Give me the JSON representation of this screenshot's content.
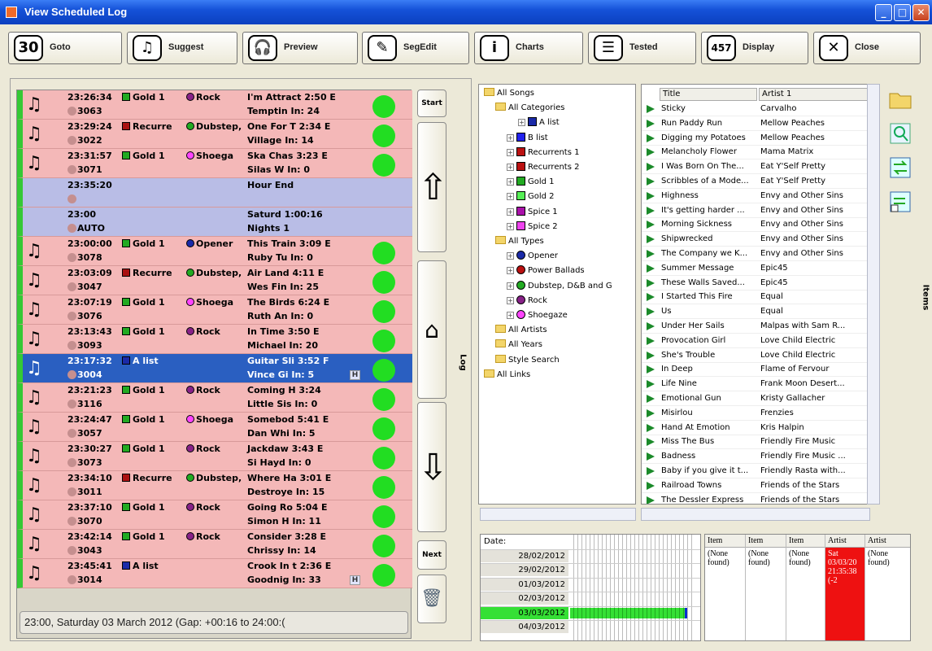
{
  "window": {
    "title": "View Scheduled Log"
  },
  "toolbar": [
    {
      "label": "Goto",
      "icon": "calendar-30-icon",
      "icon_text": "30"
    },
    {
      "label": "Suggest",
      "icon": "suggest-music-icon",
      "icon_text": "♫"
    },
    {
      "label": "Preview",
      "icon": "headphones-icon",
      "icon_text": "🎧"
    },
    {
      "label": "SegEdit",
      "icon": "segedit-icon",
      "icon_text": "✎"
    },
    {
      "label": "Charts",
      "icon": "info-icon",
      "icon_text": "i"
    },
    {
      "label": "Tested",
      "icon": "list-icon",
      "icon_text": "☰"
    },
    {
      "label": "Display",
      "icon": "display-counter-icon",
      "icon_text": "457"
    },
    {
      "label": "Close",
      "icon": "close-icon",
      "icon_text": "✕"
    }
  ],
  "log": {
    "rows": [
      {
        "time": "23:26:34",
        "cat": "Gold 1",
        "catcolor": "#22aa22",
        "type": "Rock",
        "typecolor": "#882288",
        "title": "I'm Attract 2:50 E",
        "num": "3063",
        "artist": "Temptin  In: 24",
        "blue": false,
        "sel": false,
        "h": false
      },
      {
        "time": "23:29:24",
        "cat": "Recurre",
        "catcolor": "#aa1111",
        "type": "Dubstep,",
        "typecolor": "#22aa22",
        "title": "One For T  2:34 E",
        "num": "3022",
        "artist": "Village   In: 14",
        "blue": false,
        "sel": false,
        "h": false
      },
      {
        "time": "23:31:57",
        "cat": "Gold 1",
        "catcolor": "#22aa22",
        "type": "Shoega",
        "typecolor": "#ff44ff",
        "title": "Ska Chas  3:23 E",
        "num": "3071",
        "artist": "Silas W  In: 0",
        "blue": false,
        "sel": false,
        "h": false
      },
      {
        "time": "23:35:20",
        "cat": "",
        "catcolor": "",
        "type": "",
        "typecolor": "",
        "title": "Hour End",
        "num": "",
        "artist": "",
        "blue": true,
        "sel": false,
        "h": false
      },
      {
        "time": "23:00",
        "cat": "",
        "catcolor": "",
        "type": "",
        "typecolor": "",
        "title": "Saturd  1:00:16",
        "num": "AUTO",
        "artist": "Nights 1",
        "blue": true,
        "sel": false,
        "h": false
      },
      {
        "time": "23:00:00",
        "cat": "Gold 1",
        "catcolor": "#22aa22",
        "type": "Opener",
        "typecolor": "#1a2aa8",
        "title": "This Train 3:09 E",
        "num": "3078",
        "artist": "Ruby Tu  In: 0",
        "blue": false,
        "sel": false,
        "h": false
      },
      {
        "time": "23:03:09",
        "cat": "Recurre",
        "catcolor": "#aa1111",
        "type": "Dubstep,",
        "typecolor": "#22aa22",
        "title": "Air Land  4:11 E",
        "num": "3047",
        "artist": "Wes Fin  In: 25",
        "blue": false,
        "sel": false,
        "h": false
      },
      {
        "time": "23:07:19",
        "cat": "Gold 1",
        "catcolor": "#22aa22",
        "type": "Shoega",
        "typecolor": "#ff44ff",
        "title": "The Birds  6:24 E",
        "num": "3076",
        "artist": "Ruth An  In: 0",
        "blue": false,
        "sel": false,
        "h": false
      },
      {
        "time": "23:13:43",
        "cat": "Gold 1",
        "catcolor": "#22aa22",
        "type": "Rock",
        "typecolor": "#882288",
        "title": "In Time    3:50 E",
        "num": "3093",
        "artist": "Michael  In: 20",
        "blue": false,
        "sel": false,
        "h": false
      },
      {
        "time": "23:17:32",
        "cat": "A list",
        "catcolor": "#1a2aa8",
        "type": "",
        "typecolor": "",
        "title": "Guitar Sli  3:52 F",
        "num": "3004",
        "artist": "Vince Gi  In: 5",
        "blue": false,
        "sel": true,
        "h": true
      },
      {
        "time": "23:21:23",
        "cat": "Gold 1",
        "catcolor": "#22aa22",
        "type": "Rock",
        "typecolor": "#882288",
        "title": "Coming H  3:24",
        "num": "3116",
        "artist": "Little Sis In: 0",
        "blue": false,
        "sel": false,
        "h": false
      },
      {
        "time": "23:24:47",
        "cat": "Gold 1",
        "catcolor": "#22aa22",
        "type": "Shoega",
        "typecolor": "#ff44ff",
        "title": "Somebod  5:41 E",
        "num": "3057",
        "artist": "Dan Whi  In: 5",
        "blue": false,
        "sel": false,
        "h": false
      },
      {
        "time": "23:30:27",
        "cat": "Gold 1",
        "catcolor": "#22aa22",
        "type": "Rock",
        "typecolor": "#882288",
        "title": "Jackdaw   3:43 E",
        "num": "3073",
        "artist": "Si Hayd  In: 0",
        "blue": false,
        "sel": false,
        "h": false
      },
      {
        "time": "23:34:10",
        "cat": "Recurre",
        "catcolor": "#aa1111",
        "type": "Dubstep,",
        "typecolor": "#22aa22",
        "title": "Where Ha  3:01 E",
        "num": "3011",
        "artist": "Destroye In: 15",
        "blue": false,
        "sel": false,
        "h": false
      },
      {
        "time": "23:37:10",
        "cat": "Gold 1",
        "catcolor": "#22aa22",
        "type": "Rock",
        "typecolor": "#882288",
        "title": "Going Ro  5:04 E",
        "num": "3070",
        "artist": "Simon H  In: 11",
        "blue": false,
        "sel": false,
        "h": false
      },
      {
        "time": "23:42:14",
        "cat": "Gold 1",
        "catcolor": "#22aa22",
        "type": "Rock",
        "typecolor": "#882288",
        "title": "Consider  3:28 E",
        "num": "3043",
        "artist": "Chrissy   In: 14",
        "blue": false,
        "sel": false,
        "h": false
      },
      {
        "time": "23:45:41",
        "cat": "A list",
        "catcolor": "#1a2aa8",
        "type": "",
        "typecolor": "",
        "title": "Crook In t  2:36 E",
        "num": "3014",
        "artist": "Goodnig  In: 33",
        "blue": false,
        "sel": false,
        "h": true
      }
    ],
    "status": "23:00, Saturday 03 March 2012 (Gap: +00:16 to 24:00:(",
    "h_badge": "H"
  },
  "nav": {
    "start": "Start",
    "next": "Next",
    "log_tab": "Log"
  },
  "tree": [
    {
      "label": "All Songs",
      "kind": "root",
      "indent": 0
    },
    {
      "label": "All Categories",
      "kind": "folder",
      "indent": 1
    },
    {
      "label": "A list",
      "kind": "sq",
      "color": "#1a2aa8",
      "indent": 3
    },
    {
      "label": "B list",
      "kind": "sq",
      "color": "#2222ee",
      "indent": 2
    },
    {
      "label": "Recurrents 1",
      "kind": "sq",
      "color": "#bb1111",
      "indent": 2
    },
    {
      "label": "Recurrents 2",
      "kind": "sq",
      "color": "#bb1111",
      "indent": 2
    },
    {
      "label": "Gold 1",
      "kind": "sq",
      "color": "#22aa22",
      "indent": 2
    },
    {
      "label": "Gold 2",
      "kind": "sq",
      "color": "#55ee55",
      "indent": 2
    },
    {
      "label": "Spice 1",
      "kind": "sq",
      "color": "#aa11aa",
      "indent": 2
    },
    {
      "label": "Spice 2",
      "kind": "sq",
      "color": "#ee44ee",
      "indent": 2
    },
    {
      "label": "All Types",
      "kind": "folder",
      "indent": 1
    },
    {
      "label": "Opener",
      "kind": "dot",
      "color": "#1a2aa8",
      "indent": 2
    },
    {
      "label": "Power Ballads",
      "kind": "dot",
      "color": "#bb1111",
      "indent": 2
    },
    {
      "label": "Dubstep, D&B and G",
      "kind": "dot",
      "color": "#22aa22",
      "indent": 2
    },
    {
      "label": "Rock",
      "kind": "dot",
      "color": "#882288",
      "indent": 2
    },
    {
      "label": "Shoegaze",
      "kind": "dot",
      "color": "#ff44ff",
      "indent": 2
    },
    {
      "label": "All Artists",
      "kind": "plain",
      "indent": 1
    },
    {
      "label": "All Years",
      "kind": "plain",
      "indent": 1
    },
    {
      "label": "Style Search",
      "kind": "folder",
      "indent": 1
    },
    {
      "label": "All Links",
      "kind": "plain",
      "indent": 0
    }
  ],
  "grid": {
    "headers": [
      "Title",
      "Artist 1"
    ],
    "rows": [
      [
        "Sticky",
        "Carvalho"
      ],
      [
        "Run Paddy Run",
        "Mellow Peaches"
      ],
      [
        "Digging my Potatoes",
        "Mellow Peaches"
      ],
      [
        "Melancholy Flower",
        "Mama Matrix"
      ],
      [
        "I Was Born On The...",
        "Eat Y'Self Pretty"
      ],
      [
        "Scribbles of a Mode...",
        "Eat Y'Self Pretty"
      ],
      [
        "Highness",
        "Envy and Other Sins"
      ],
      [
        "It's getting harder ...",
        "Envy and Other Sins"
      ],
      [
        "Morning Sickness",
        "Envy and Other Sins"
      ],
      [
        "Shipwrecked",
        "Envy and Other Sins"
      ],
      [
        "The Company we K...",
        "Envy and Other Sins"
      ],
      [
        "Summer Message",
        "Epic45"
      ],
      [
        "These Walls Saved...",
        "Epic45"
      ],
      [
        "I Started This Fire",
        "Equal"
      ],
      [
        "Us",
        "Equal"
      ],
      [
        "Under Her Sails",
        "Malpas with Sam R..."
      ],
      [
        "Provocation Girl",
        "Love Child Electric"
      ],
      [
        "She's Trouble",
        "Love Child Electric"
      ],
      [
        "In Deep",
        "Flame of Fervour"
      ],
      [
        "Life Nine",
        "Frank Moon Desert..."
      ],
      [
        "Emotional Gun",
        "Kristy Gallacher"
      ],
      [
        "Misirlou",
        "Frenzies"
      ],
      [
        "Hand At Emotion",
        "Kris Halpin"
      ],
      [
        "Miss The Bus",
        "Friendly Fire Music"
      ],
      [
        "Badness",
        "Friendly Fire Music ..."
      ],
      [
        "Baby if you give it t...",
        "Friendly Rasta with..."
      ],
      [
        "Railroad Towns",
        "Friends of the Stars"
      ],
      [
        "The Dessler Express",
        "Friends of the Stars"
      ]
    ],
    "items_tab": "Items"
  },
  "dates": {
    "label": "Date:",
    "rows": [
      "28/02/2012",
      "29/02/2012",
      "01/03/2012",
      "02/03/2012",
      "03/03/2012",
      "04/03/2012"
    ],
    "highlight_index": 4
  },
  "items": {
    "cols": [
      {
        "h": "Item",
        "v": "(None found)",
        "red": false
      },
      {
        "h": "Item",
        "v": "(None found)",
        "red": false
      },
      {
        "h": "Item",
        "v": "(None found)",
        "red": false
      },
      {
        "h": "Artist",
        "v": "Sat 03/03/20 21:35:38 (-2",
        "red": true
      },
      {
        "h": "Artist",
        "v": "(None found)",
        "red": false
      }
    ]
  }
}
